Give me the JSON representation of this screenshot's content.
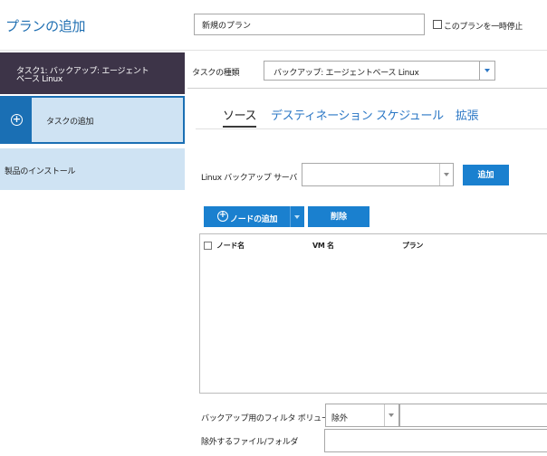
{
  "header": {
    "title": "プランの追加",
    "plan_name_value": "新規のプラン",
    "pause_plan_label": "このプランを一時停止"
  },
  "sidebar": {
    "items": [
      {
        "label_line1": "タスク1: バックアップ: エージェント",
        "label_line2": "ベース Linux"
      },
      {
        "label": "タスクの追加",
        "icon": "plus-circle-icon"
      },
      {
        "label": "製品のインストール"
      }
    ]
  },
  "task_type": {
    "label": "タスクの種類",
    "selected": "バックアップ: エージェントベース Linux"
  },
  "tabs": [
    {
      "label": "ソース",
      "active": true
    },
    {
      "label": "デスティネーション",
      "active": false
    },
    {
      "label": "スケジュール",
      "active": false
    },
    {
      "label": "拡張",
      "active": false
    }
  ],
  "source": {
    "backup_server_label": "Linux バックアップ サーバ",
    "backup_server_value": "",
    "add_button_label": "追加",
    "add_node_button_label": "ノードの追加",
    "delete_button_label": "削除",
    "table_columns": [
      "ノード名",
      "VM 名",
      "プラン"
    ],
    "table_rows": [],
    "filter_volume_label": "バックアップ用のフィルタ ボリューム",
    "filter_volume_selected": "除外",
    "filter_volume_value": "",
    "exclude_label": "除外するファイル/フォルダ",
    "exclude_value": ""
  },
  "colors": {
    "accent": "#1a80cf",
    "title_blue": "#1f6fb2",
    "sidebar_dark": "#3d3448",
    "sidebar_light": "#cfe3f3"
  }
}
